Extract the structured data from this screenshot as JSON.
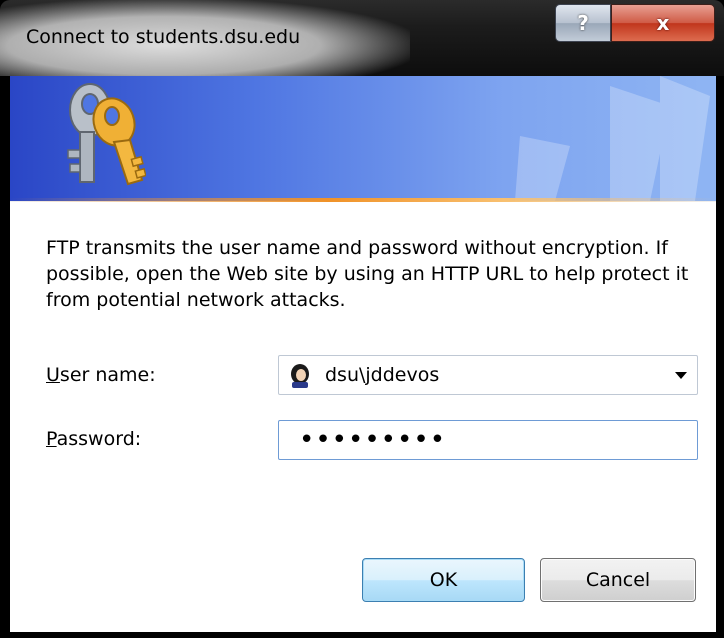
{
  "window": {
    "title": "Connect to students.dsu.edu",
    "help_label": "?",
    "close_label": "x"
  },
  "message": "FTP transmits the user name and password without encryption. If possible, open the Web site by using an HTTP URL to help protect it from potential network attacks.",
  "username": {
    "label_first": "U",
    "label_rest": "ser name:",
    "value": "dsu\\jddevos"
  },
  "password": {
    "label_first": "P",
    "label_rest": "assword:",
    "value": "•••••••••"
  },
  "buttons": {
    "ok": "OK",
    "cancel": "Cancel"
  },
  "icons": {
    "banner": "keys-icon",
    "user": "user-icon",
    "dropdown": "chevron-down-icon"
  }
}
